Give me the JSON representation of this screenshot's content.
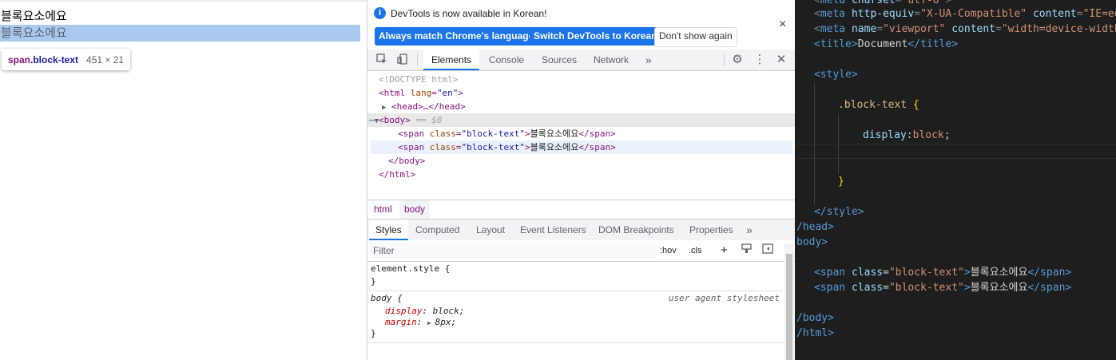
{
  "page": {
    "line1": "블록요소에요",
    "line2": "블록요소에요",
    "tooltip": {
      "tag": "span",
      "cls": ".block-text",
      "size": "451 × 21"
    }
  },
  "devtools": {
    "infobar": {
      "message": "DevTools is now available in Korean!",
      "btn_match": "Always match Chrome's language",
      "btn_switch": "Switch DevTools to Korean",
      "btn_dont": "Don't show again",
      "close": "×"
    },
    "tabs": [
      "Elements",
      "Console",
      "Sources",
      "Network"
    ],
    "more": "»",
    "dom": {
      "doctype": "<!DOCTYPE html>",
      "html_open_tag": "<html",
      "html_lang_attr": "lang",
      "html_lang_val": "\"en\"",
      "head": "<head>…</head>",
      "body_tag": "<body>",
      "body_eq": "== $0",
      "span_open": "<span",
      "span_class_attr": "class",
      "span_class_val": "\"block-text\"",
      "span_text": "블록요소에요",
      "span_close": "</span>",
      "body_close": "</body>",
      "html_close": "</html>"
    },
    "breadcrumbs": [
      "html",
      "body"
    ],
    "subtabs": [
      "Styles",
      "Computed",
      "Layout",
      "Event Listeners",
      "DOM Breakpoints",
      "Properties"
    ],
    "filter": {
      "placeholder": "Filter",
      "hov": ":hov",
      "cls": ".cls",
      "plus": "+"
    },
    "styles": {
      "element_style": "element.style {",
      "close_brace": "}",
      "body_selector": "body {",
      "ua_label": "user agent stylesheet",
      "prop1": "display",
      "val1": "block;",
      "prop2": "margin",
      "val2": "8px;"
    }
  },
  "editor": {
    "l0_attr": "charset",
    "l0_val": "\"utf-8\"",
    "l1_attr1": "http-equiv",
    "l1_val1": "\"X-UA-Compatible\"",
    "l1_attr2": "content",
    "l1_val2": "\"IE=ed",
    "l2_attr1": "name",
    "l2_val1": "\"viewport\"",
    "l2_attr2": "content",
    "l2_val2": "\"width=device-width",
    "title_open": "<title>",
    "title_text": "Document",
    "title_close": "</title>",
    "style_open": "<style>",
    "selector": ".block-text",
    "brace_open": "{",
    "prop": "display",
    "colon": ":",
    "value": "block",
    "semi": ";",
    "brace_close": "}",
    "style_close": "</style>",
    "head_close": "/head>",
    "body_open": "body>",
    "span_open": "<span",
    "span_attr": "class",
    "span_eq": "=",
    "span_val": "\"block-text\"",
    "span_gt": ">",
    "span_text": "블록요소에요",
    "span_close": "</span>",
    "body_close": "/body>",
    "html_close": "/html>"
  }
}
